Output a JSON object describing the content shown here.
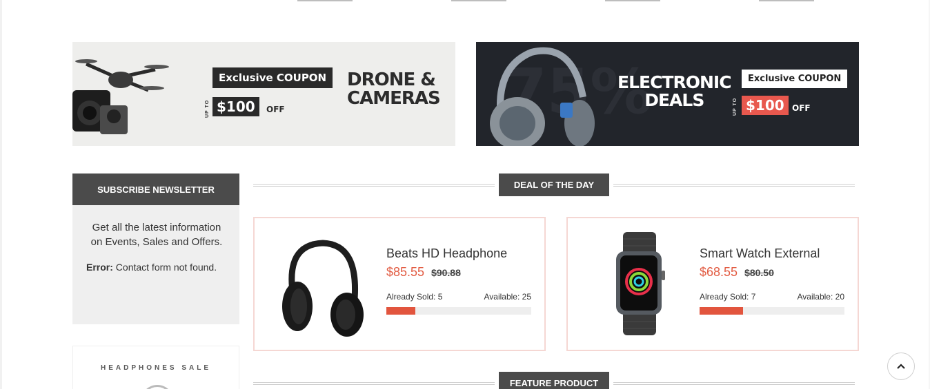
{
  "banners": [
    {
      "coupon_label": "Exclusive COUPON",
      "upto_label": "UP TO",
      "amount": "$100",
      "off_label": "OFF",
      "heading_line1": "DRONE &",
      "heading_line2": "CAMERAS"
    },
    {
      "big_number": "75%",
      "heading_line1": "ELECTRONIC",
      "heading_line2": "DEALS",
      "coupon_label": "Exclusive COUPON",
      "upto_label": "UP TO",
      "amount": "$100",
      "off_label": "OFF"
    }
  ],
  "newsletter": {
    "title": "SUBSCRIBE NEWSLETTER",
    "text": "Get all the latest information on Events, Sales and Offers.",
    "error_label": "Error:",
    "error_text": " Contact form not found."
  },
  "sidebar_promo": {
    "title": "HEADPHONES SALE"
  },
  "sections": {
    "deal_of_the_day": "DEAL OF THE DAY",
    "feature_product": "FEATURE PRODUCT"
  },
  "deals": [
    {
      "name": "Beats HD Headphone",
      "price": "$85.55",
      "old_price": "$90.88",
      "sold_text": "Already Sold: 5",
      "available_text": "Available: 25",
      "sold_fraction": 0.2
    },
    {
      "name": "Smart Watch External",
      "price": "$68.55",
      "old_price": "$80.50",
      "sold_text": "Already Sold: 7",
      "available_text": "Available: 20",
      "sold_fraction": 0.3
    }
  ],
  "colors": {
    "accent_red": "#e25c43",
    "dark_label": "#4b4b4b",
    "card_border": "#f5d7d3"
  },
  "icons": {
    "back_to_top": "chevron-up-icon"
  }
}
